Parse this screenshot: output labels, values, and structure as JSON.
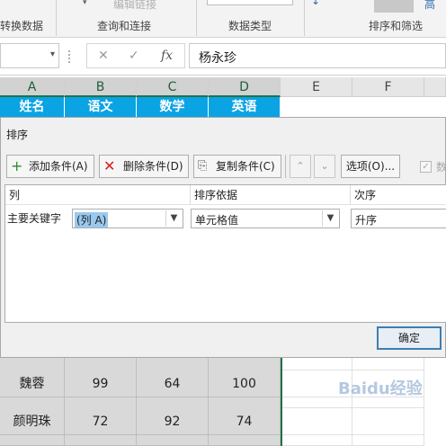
{
  "ribbon": {
    "items": [
      "转换数据",
      "编辑链接",
      "查询和连接",
      "数据类型",
      "排序和筛选",
      "高"
    ]
  },
  "formula_bar": {
    "name_box": "",
    "cancel_glyph": "✕",
    "enter_glyph": "✓",
    "fx_glyph": "fx",
    "content": "杨永珍"
  },
  "columns": [
    "A",
    "B",
    "C",
    "D",
    "E",
    "F"
  ],
  "header_row": [
    "姓名",
    "语文",
    "数学",
    "英语"
  ],
  "dialog": {
    "title": "排序",
    "toolbar": {
      "add_label": "添加条件(A)",
      "delete_label": "删除条件(D)",
      "copy_label": "复制条件(C)",
      "move_up_glyph": "⌃",
      "move_down_glyph": "⌄",
      "options_label": "选项(O)...",
      "has_header_label": "数"
    },
    "grid": {
      "headers": [
        "列",
        "排序依据",
        "次序"
      ],
      "row_label": "主要关键字",
      "sort_key": "(列 A)",
      "sort_on": "单元格值",
      "order": "升序"
    },
    "ok_label": "确定"
  },
  "rows": [
    [
      "魏蓉",
      "99",
      "64",
      "100"
    ],
    [
      "颜明珠",
      "72",
      "92",
      "74"
    ]
  ],
  "watermark": "Baidu经验",
  "colors": {
    "header_fill": "#0aa3e4",
    "selection": "#99c9ef",
    "excel_green": "#217346"
  }
}
